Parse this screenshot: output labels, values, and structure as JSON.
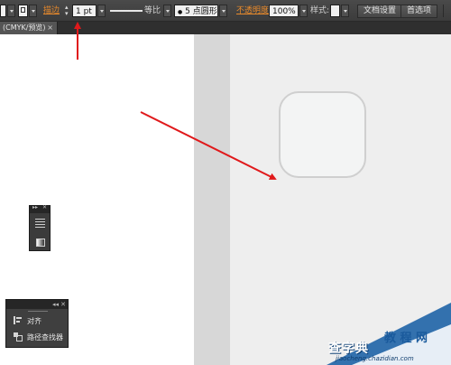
{
  "control_bar": {
    "stroke_label": "描边",
    "stroke_weight": "1 pt",
    "profile_label": "等比",
    "brush_label": "5 点圆形",
    "opacity_label": "不透明度",
    "opacity_value": "100%",
    "style_label": "样式:",
    "doc_setup_button": "文档设置",
    "preferences_button": "首选项"
  },
  "document_tab": {
    "title": "(CMYK/预览)",
    "close": "×"
  },
  "align_panel": {
    "items": [
      {
        "label": "对齐",
        "icon": "align-icon"
      },
      {
        "label": "路径查找器",
        "icon": "pathfinder-icon"
      }
    ]
  },
  "watermark": {
    "line1": "查字典",
    "line2": "教 程 网",
    "line3": "jiaocheng.chazidian.com"
  },
  "colors": {
    "annotation_arrow": "#e0191b",
    "accent_label": "#e98a2b"
  }
}
